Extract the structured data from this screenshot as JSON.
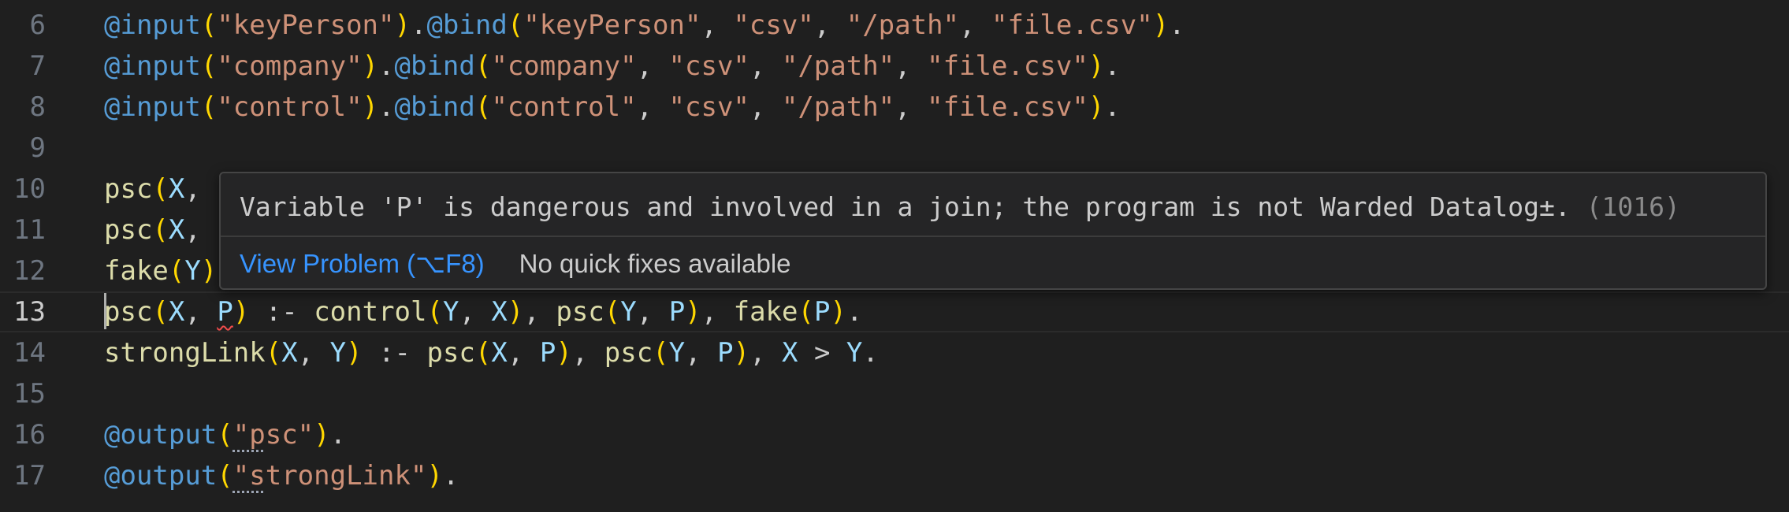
{
  "editor": {
    "lines": [
      {
        "num": "6",
        "tokens": [
          [
            "kw",
            "@input"
          ],
          [
            "par",
            "("
          ],
          [
            "str",
            "\"keyPerson\""
          ],
          [
            "par",
            ")"
          ],
          [
            "punc",
            "."
          ],
          [
            "kw",
            "@bind"
          ],
          [
            "par",
            "("
          ],
          [
            "str",
            "\"keyPerson\""
          ],
          [
            "punc",
            ", "
          ],
          [
            "str",
            "\"csv\""
          ],
          [
            "punc",
            ", "
          ],
          [
            "str",
            "\"/path\""
          ],
          [
            "punc",
            ", "
          ],
          [
            "str",
            "\"file.csv\""
          ],
          [
            "par",
            ")"
          ],
          [
            "punc",
            "."
          ]
        ]
      },
      {
        "num": "7",
        "tokens": [
          [
            "kw",
            "@input"
          ],
          [
            "par",
            "("
          ],
          [
            "str",
            "\"company\""
          ],
          [
            "par",
            ")"
          ],
          [
            "punc",
            "."
          ],
          [
            "kw",
            "@bind"
          ],
          [
            "par",
            "("
          ],
          [
            "str",
            "\"company\""
          ],
          [
            "punc",
            ", "
          ],
          [
            "str",
            "\"csv\""
          ],
          [
            "punc",
            ", "
          ],
          [
            "str",
            "\"/path\""
          ],
          [
            "punc",
            ", "
          ],
          [
            "str",
            "\"file.csv\""
          ],
          [
            "par",
            ")"
          ],
          [
            "punc",
            "."
          ]
        ]
      },
      {
        "num": "8",
        "tokens": [
          [
            "kw",
            "@input"
          ],
          [
            "par",
            "("
          ],
          [
            "str",
            "\"control\""
          ],
          [
            "par",
            ")"
          ],
          [
            "punc",
            "."
          ],
          [
            "kw",
            "@bind"
          ],
          [
            "par",
            "("
          ],
          [
            "str",
            "\"control\""
          ],
          [
            "punc",
            ", "
          ],
          [
            "str",
            "\"csv\""
          ],
          [
            "punc",
            ", "
          ],
          [
            "str",
            "\"/path\""
          ],
          [
            "punc",
            ", "
          ],
          [
            "str",
            "\"file.csv\""
          ],
          [
            "par",
            ")"
          ],
          [
            "punc",
            "."
          ]
        ]
      },
      {
        "num": "9",
        "tokens": []
      },
      {
        "num": "10",
        "tokens": [
          [
            "pred",
            "psc"
          ],
          [
            "par",
            "("
          ],
          [
            "var",
            "X"
          ],
          [
            "punc",
            ","
          ]
        ]
      },
      {
        "num": "11",
        "tokens": [
          [
            "pred",
            "psc"
          ],
          [
            "par",
            "("
          ],
          [
            "var",
            "X"
          ],
          [
            "punc",
            ","
          ]
        ]
      },
      {
        "num": "12",
        "tokens": [
          [
            "pred",
            "fake"
          ],
          [
            "par",
            "("
          ],
          [
            "var",
            "Y"
          ],
          [
            "par",
            ")"
          ]
        ]
      },
      {
        "num": "13",
        "current": true,
        "tokens": [
          [
            "pred",
            "psc"
          ],
          [
            "par",
            "("
          ],
          [
            "var",
            "X"
          ],
          [
            "punc",
            ", "
          ],
          [
            "var squig",
            "P"
          ],
          [
            "par",
            ")"
          ],
          [
            "op",
            " :- "
          ],
          [
            "pred",
            "control"
          ],
          [
            "par",
            "("
          ],
          [
            "var",
            "Y"
          ],
          [
            "punc",
            ", "
          ],
          [
            "var",
            "X"
          ],
          [
            "par",
            ")"
          ],
          [
            "punc",
            ", "
          ],
          [
            "pred",
            "psc"
          ],
          [
            "par",
            "("
          ],
          [
            "var",
            "Y"
          ],
          [
            "punc",
            ", "
          ],
          [
            "var",
            "P"
          ],
          [
            "par",
            ")"
          ],
          [
            "punc",
            ", "
          ],
          [
            "pred",
            "fake"
          ],
          [
            "par",
            "("
          ],
          [
            "var",
            "P"
          ],
          [
            "par",
            ")"
          ],
          [
            "punc",
            "."
          ]
        ]
      },
      {
        "num": "14",
        "tokens": [
          [
            "pred",
            "strongLink"
          ],
          [
            "par",
            "("
          ],
          [
            "var",
            "X"
          ],
          [
            "punc",
            ", "
          ],
          [
            "var",
            "Y"
          ],
          [
            "par",
            ")"
          ],
          [
            "op",
            " :- "
          ],
          [
            "pred",
            "psc"
          ],
          [
            "par",
            "("
          ],
          [
            "var",
            "X"
          ],
          [
            "punc",
            ", "
          ],
          [
            "var",
            "P"
          ],
          [
            "par",
            ")"
          ],
          [
            "punc",
            ", "
          ],
          [
            "pred",
            "psc"
          ],
          [
            "par",
            "("
          ],
          [
            "var",
            "Y"
          ],
          [
            "punc",
            ", "
          ],
          [
            "var",
            "P"
          ],
          [
            "par",
            ")"
          ],
          [
            "punc",
            ", "
          ],
          [
            "var",
            "X"
          ],
          [
            "op",
            " > "
          ],
          [
            "var",
            "Y"
          ],
          [
            "punc",
            "."
          ]
        ]
      },
      {
        "num": "15",
        "tokens": []
      },
      {
        "num": "16",
        "tokens": [
          [
            "kw",
            "@output"
          ],
          [
            "par",
            "("
          ],
          [
            "str dots",
            "\"p"
          ],
          [
            "str",
            "sc\""
          ],
          [
            "par",
            ")"
          ],
          [
            "punc",
            "."
          ]
        ]
      },
      {
        "num": "17",
        "tokens": [
          [
            "kw",
            "@output"
          ],
          [
            "par",
            "("
          ],
          [
            "str dots",
            "\"s"
          ],
          [
            "str",
            "trongLink\""
          ],
          [
            "par",
            ")"
          ],
          [
            "punc",
            "."
          ]
        ]
      }
    ]
  },
  "hover": {
    "message": "Variable 'P' is dangerous and involved in a join; the program is not Warded Datalog±.",
    "code": "(1016)",
    "view_problem": "View Problem (⌥F8)",
    "no_fixes": "No quick fixes available"
  }
}
